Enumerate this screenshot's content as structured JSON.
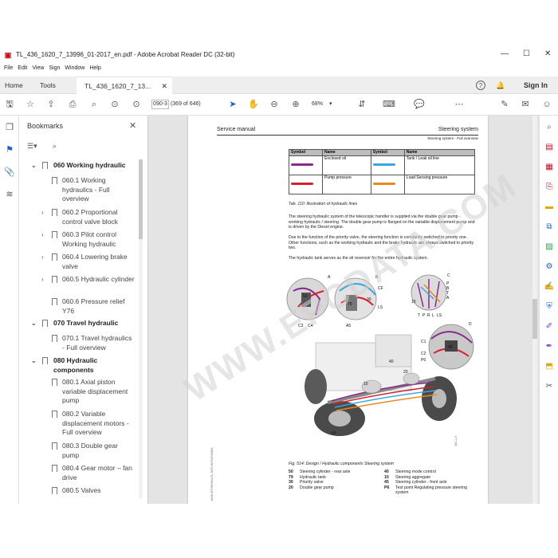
{
  "window": {
    "title": "TL_436_1620_7_13996_01-2017_en.pdf - Adobe Acrobat Reader DC (32-bit)",
    "menu": [
      "File",
      "Edit",
      "View",
      "Sign",
      "Window",
      "Help"
    ]
  },
  "tabs": {
    "home": "Home",
    "tools": "Tools",
    "doc": "TL_436_1620_7_13...",
    "signin": "Sign In"
  },
  "toolbar": {
    "page_current": "090-3",
    "page_of": "(369 of 646)",
    "zoom": "68%"
  },
  "bookmarks": {
    "title": "Bookmarks",
    "items": [
      {
        "label": "060 Working hydraulic",
        "level": 0,
        "expanded": true,
        "bold": true
      },
      {
        "label": "060.1 Working hydraulics - Full overview",
        "level": 1,
        "expanded": null
      },
      {
        "label": "060.2 Proportional control valve block",
        "level": 1,
        "expanded": false
      },
      {
        "label": "060.3 Pilot control Working hydraulic",
        "level": 1,
        "expanded": false
      },
      {
        "label": "060.4 Lowering brake valve",
        "level": 1,
        "expanded": false
      },
      {
        "label": "060.5 Hydraulic cylinder",
        "level": 1,
        "expanded": false
      },
      {
        "label": "060.6 Pressure relief Y76",
        "level": 1,
        "expanded": null
      },
      {
        "label": "070 Travel hydraulic",
        "level": 0,
        "expanded": true,
        "bold": true
      },
      {
        "label": "070.1 Travel hydraulics - Full overview",
        "level": 1,
        "expanded": null
      },
      {
        "label": "080 Hydraulic components",
        "level": 0,
        "expanded": true,
        "bold": true
      },
      {
        "label": "080.1 Axial piston variable displacement pump",
        "level": 1,
        "expanded": null
      },
      {
        "label": "080.2 Variable displacement motors - Full overview",
        "level": 1,
        "expanded": null
      },
      {
        "label": "080.3 Double gear pump",
        "level": 1,
        "expanded": null
      },
      {
        "label": "080.4 Gear motor – fan drive",
        "level": 1,
        "expanded": null
      },
      {
        "label": "080.5 Valves",
        "level": 1,
        "expanded": null
      }
    ]
  },
  "page": {
    "header_left": "Service manual",
    "header_right": "Steering system",
    "subheader": "Steering system - Full overview",
    "table_headers": [
      "Symbol",
      "Name",
      "Symbol",
      "Name"
    ],
    "table_rows": [
      {
        "name1": "Enclosed oil",
        "color1": "#8a2a8f",
        "name2": "Tank / Leak oil line",
        "color2": "#3aa6df"
      },
      {
        "name1": "Pump pressure",
        "color1": "#d9202a",
        "name2": "Load Sensing pressure",
        "color2": "#e9891d"
      }
    ],
    "tab_caption": "Tab. 110: Illustration of hydraulic lines",
    "para1": "The steering hydraulic system of the telescopic handler is supplied via the double gear pump - working hydraulic / steering. The double gear pump is flanged on the variable displacement pump and is driven by the Diesel engine.",
    "para2": "Due to the function of the priority valve, the steering function is constantly switched to priority one. Other functions, such as the working hydraulic and the brake hydraulic are always switched to priority two.",
    "para3": "The hydraulic tank serves as the oil reservoir for the entire hydraulic system.",
    "fig_labels": [
      "A",
      "B",
      "C",
      "D",
      "C3",
      "C4",
      "A5",
      "CF",
      "P",
      "B",
      "T",
      "A",
      "30",
      "10",
      "LS",
      "T",
      "P",
      "R",
      "L",
      "LS",
      "C1",
      "C2",
      "P6",
      "50",
      "79",
      "40",
      "45",
      "10",
      "50",
      "20"
    ],
    "fig_caption": "Fig. 514: Design / Hydraulic components Steering system",
    "legend_left": [
      {
        "num": "50",
        "text": "Steering cylinder - rear axle"
      },
      {
        "num": "79",
        "text": "Hydraulic tank"
      },
      {
        "num": "30",
        "text": "Priority valve"
      },
      {
        "num": "20",
        "text": "Double gear pump"
      }
    ],
    "legend_right": [
      {
        "num": "40",
        "text": "Steering mode control"
      },
      {
        "num": "10",
        "text": "Steering aggregate"
      },
      {
        "num": "45",
        "text": "Steering cylinder - front axle"
      },
      {
        "num": "P6",
        "text": "Test point Regulating pressure steering system"
      }
    ],
    "side_code": "LWW-/E/TH0/36xx/TL-36/TL36/TC/P44/M/L",
    "side_code2": "AS1-1-3",
    "watermark": "WWW.EPCDATA.COM"
  }
}
